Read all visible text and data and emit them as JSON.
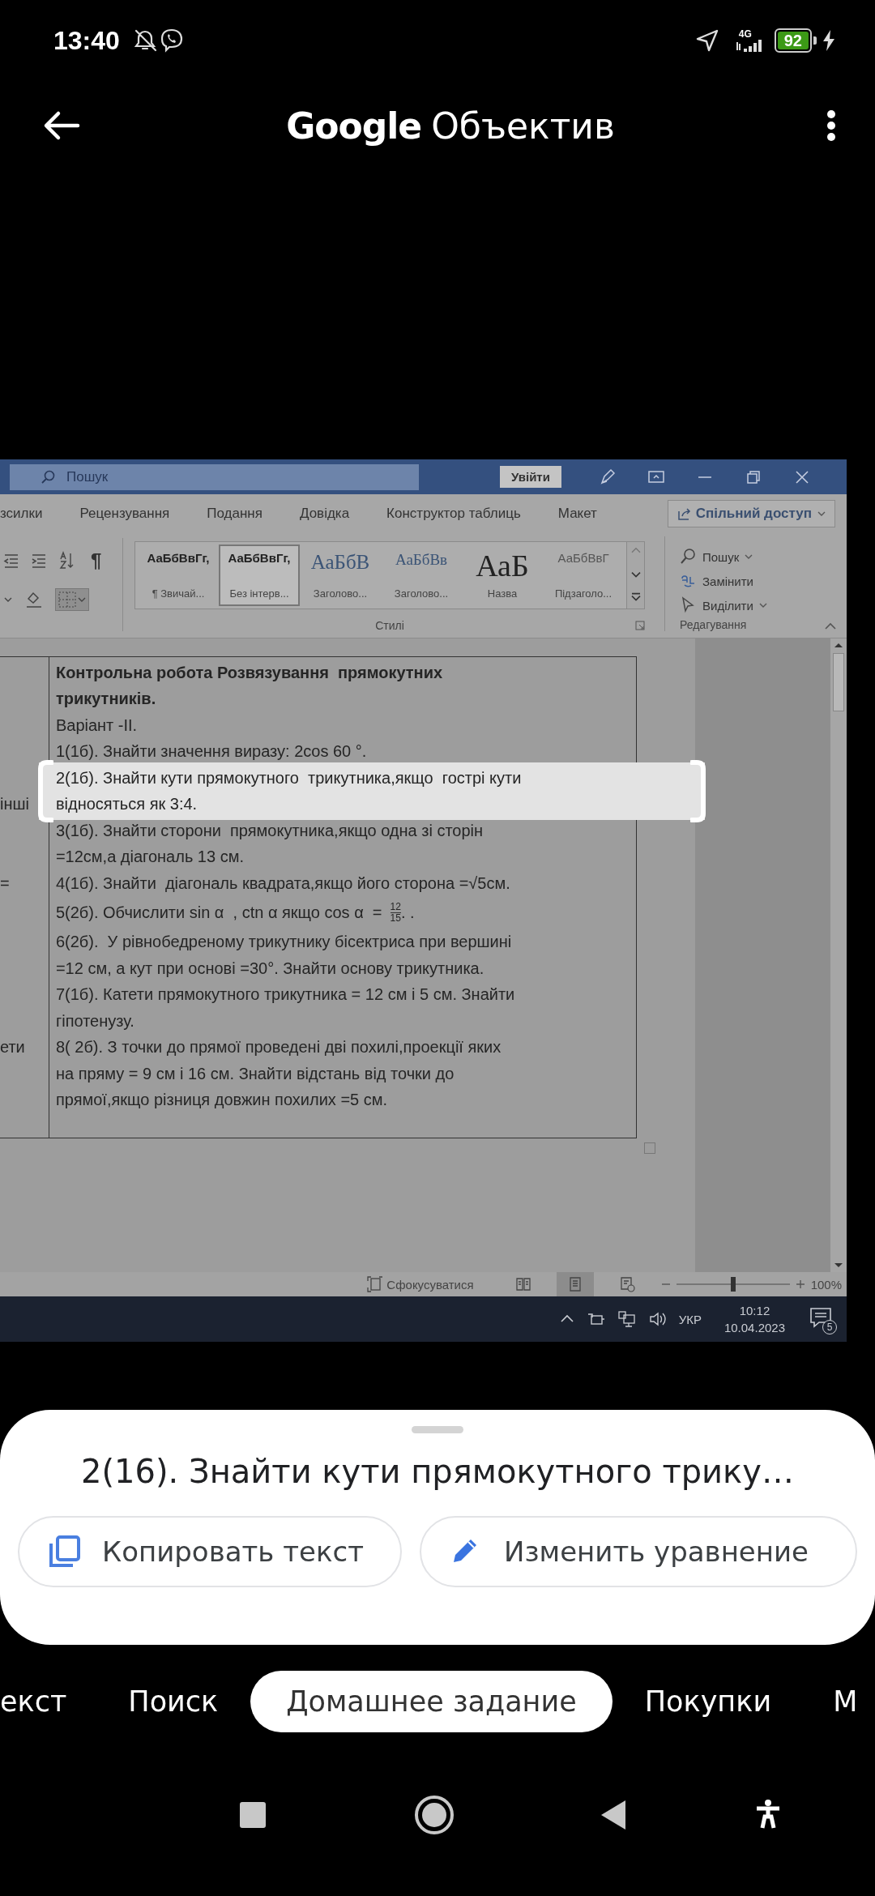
{
  "status_bar": {
    "time": "13:40",
    "network": "4G",
    "battery": "92"
  },
  "header": {
    "brand": "Google",
    "title": "Объектив"
  },
  "word": {
    "search": {
      "placeholder": "Пошук"
    },
    "sign_in": "Увійти",
    "ribbon_tabs": [
      "зсилки",
      "Рецензування",
      "Подання",
      "Довідка",
      "Конструктор таблиць",
      "Макет"
    ],
    "share": "Спільний доступ",
    "pilcrow": "¶",
    "styles": [
      {
        "sample": "АаБбВвГг,",
        "name": "¶ Звичай...",
        "kind": "normal",
        "selected": false
      },
      {
        "sample": "АаБбВвГг,",
        "name": "Без інтерв...",
        "kind": "normal",
        "selected": true
      },
      {
        "sample": "АаБбВ",
        "name": "Заголово...",
        "kind": "heading1",
        "selected": false
      },
      {
        "sample": "АаБбВв",
        "name": "Заголово...",
        "kind": "heading2",
        "selected": false
      },
      {
        "sample": "АаБ",
        "name": "Назва",
        "kind": "title",
        "selected": false
      },
      {
        "sample": "АаБбВвГ",
        "name": "Підзаголо...",
        "kind": "subtitle",
        "selected": false
      }
    ],
    "styles_label": "Стилі",
    "editing": [
      {
        "label": "Пошук",
        "kind": "find"
      },
      {
        "label": "Замінити",
        "kind": "replace"
      },
      {
        "label": "Виділити",
        "kind": "select"
      }
    ],
    "editing_label": "Редагування",
    "document": {
      "lines": [
        {
          "kind": "text",
          "text": "Контрольна робота Розвязування  прямокутних",
          "bold": true,
          "highlighted": false
        },
        {
          "kind": "text",
          "text": "трикутників.",
          "bold": true,
          "highlighted": false
        },
        {
          "kind": "text",
          "text": "Варіант -II.",
          "bold": false,
          "highlighted": false
        },
        {
          "kind": "text",
          "text": "1(1б). Знайти значення виразу: 2cos 60 °.",
          "bold": false,
          "highlighted": false
        },
        {
          "kind": "text",
          "text": "2(1б). Знайти кути прямокутного  трикутника,якщо  гострі кути",
          "bold": false,
          "highlighted": true
        },
        {
          "kind": "text",
          "text": "відносяться як 3:4.",
          "bold": false,
          "highlighted": true,
          "margin_text": "інші"
        },
        {
          "kind": "text",
          "text": "3(1б). Знайти сторони  прямокутника,якщо одна зі сторін",
          "bold": false,
          "highlighted": false
        },
        {
          "kind": "text",
          "text": "=12см,а діагональ 13 см.",
          "bold": false,
          "highlighted": false
        },
        {
          "kind": "text",
          "text": "4(1б). Знайти  діагональ квадрата,якщо його сторона =√5см.",
          "bold": false,
          "highlighted": false,
          "margin_text": "="
        },
        {
          "kind": "fraction",
          "text": "5(2б). Обчислити sin α  , ctn α якщо cos α  =",
          "numerator": "12",
          "denominator": "15",
          "tail": ". .",
          "bold": false,
          "highlighted": false
        },
        {
          "kind": "text",
          "text": "6(2б).  У рівнобедреному трикутнику бісектриса при вершині",
          "bold": false,
          "highlighted": false
        },
        {
          "kind": "text",
          "text": "=12 см, а кут при основі =30°. Знайти основу трикутника.",
          "bold": false,
          "highlighted": false
        },
        {
          "kind": "text",
          "text": "7(1б). Катети прямокутного трикутника = 12 см і 5 см. Знайти",
          "bold": false,
          "highlighted": false
        },
        {
          "kind": "text",
          "text": "гіпотенузу.",
          "bold": false,
          "highlighted": false
        },
        {
          "kind": "text",
          "text": "8( 2б). З точки до прямої проведені дві похилі,проекції яких",
          "bold": false,
          "highlighted": false,
          "margin_text": "ети"
        },
        {
          "kind": "text",
          "text": "на пряму = 9 см і 16 см. Знайти відстань від точки до",
          "bold": false,
          "highlighted": false
        },
        {
          "kind": "text",
          "text": "прямої,якщо різниця довжин похилих =5 см.",
          "bold": false,
          "highlighted": false
        }
      ]
    },
    "status": {
      "focus": "Сфокусуватися",
      "views": [
        {
          "kind": "read",
          "selected": false
        },
        {
          "kind": "print",
          "selected": true
        },
        {
          "kind": "web",
          "selected": false
        }
      ],
      "zoom": {
        "level": 0.5,
        "reading": "100%"
      }
    },
    "taskbar": {
      "language": "УКР",
      "time": "10:12",
      "date": "10.04.2023",
      "notifications": "5"
    }
  },
  "result": {
    "text": "2(16). Знайти кути прямокутного трику…",
    "actions": [
      {
        "label": "Копировать текст",
        "kind": "copy"
      },
      {
        "label": "Изменить уравнение",
        "kind": "edit"
      }
    ]
  },
  "modes": [
    {
      "label": "екст",
      "selected": false
    },
    {
      "label": "Поиск",
      "selected": false
    },
    {
      "label": "Домашнее задание",
      "selected": true
    },
    {
      "label": "Покупки",
      "selected": false
    },
    {
      "label": "М",
      "selected": false
    }
  ]
}
